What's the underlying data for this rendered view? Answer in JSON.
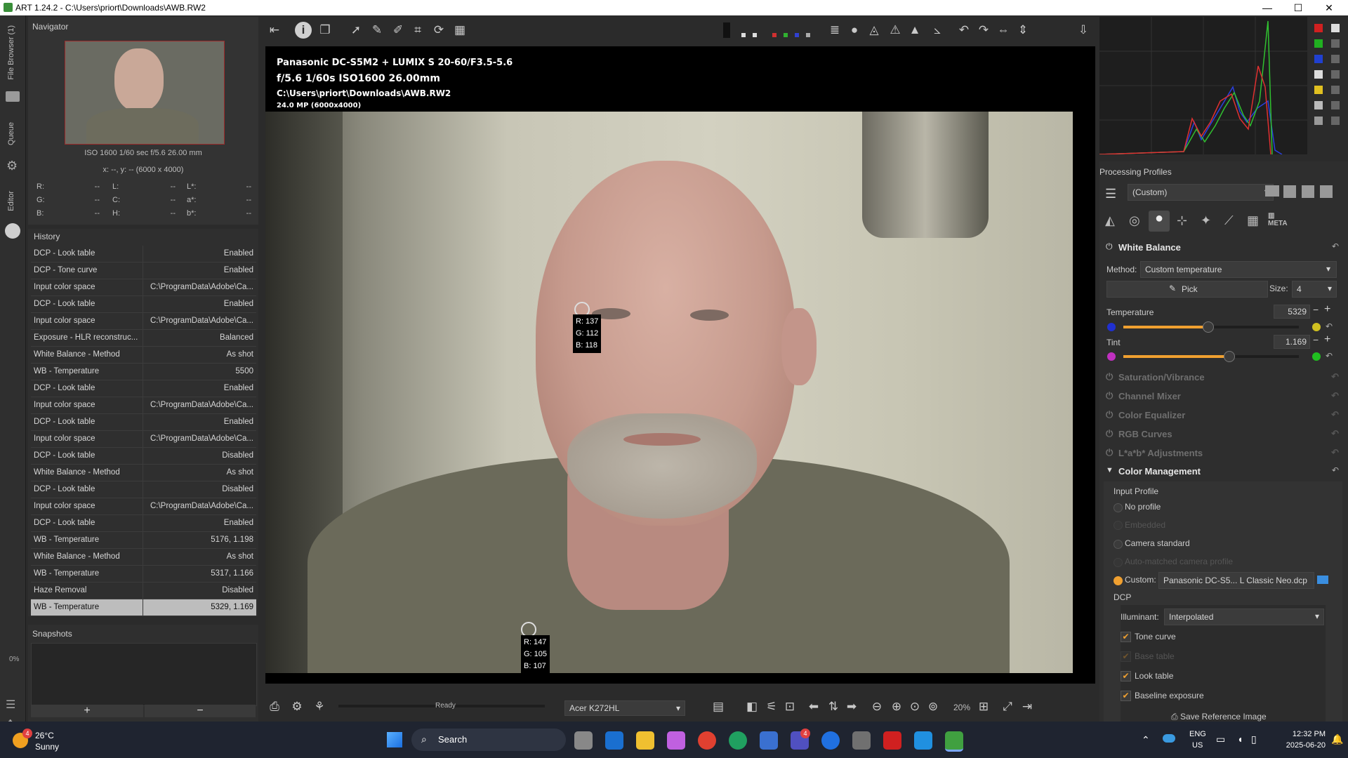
{
  "window": {
    "title": "ART 1.24.2 - C:\\Users\\priort\\Downloads\\AWB.RW2",
    "minimize_icon": "minimize-icon",
    "maximize_icon": "maximize-icon",
    "close_icon": "close-icon"
  },
  "left_tabs": [
    "File Browser (1)",
    "Queue",
    "Editor"
  ],
  "navigator": {
    "title": "Navigator",
    "exif": "ISO 1600   1/60 sec   f/5.6   26.00 mm",
    "coords": "x: --, y: --    (6000 x 4000)",
    "readouts": [
      {
        "k1": "R:",
        "v1": "--",
        "k2": "L:",
        "v2": "--",
        "k3": "L*:",
        "v3": "--"
      },
      {
        "k1": "G:",
        "v1": "--",
        "k2": "C:",
        "v2": "--",
        "k3": "a*:",
        "v3": "--"
      },
      {
        "k1": "B:",
        "v1": "--",
        "k2": "H:",
        "v2": "--",
        "k3": "b*:",
        "v3": "--"
      }
    ]
  },
  "history": {
    "title": "History",
    "rows": [
      {
        "name": "DCP - Look table",
        "value": "Enabled"
      },
      {
        "name": "DCP - Tone curve",
        "value": "Enabled"
      },
      {
        "name": "Input color space",
        "value": "C:\\ProgramData\\Adobe\\Ca..."
      },
      {
        "name": "DCP - Look table",
        "value": "Enabled"
      },
      {
        "name": "Input color space",
        "value": "C:\\ProgramData\\Adobe\\Ca..."
      },
      {
        "name": "Exposure - HLR reconstruc...",
        "value": "Balanced"
      },
      {
        "name": "White Balance - Method",
        "value": "As shot"
      },
      {
        "name": "WB - Temperature",
        "value": "5500"
      },
      {
        "name": "DCP - Look table",
        "value": "Enabled"
      },
      {
        "name": "Input color space",
        "value": "C:\\ProgramData\\Adobe\\Ca..."
      },
      {
        "name": "DCP - Look table",
        "value": "Enabled"
      },
      {
        "name": "Input color space",
        "value": "C:\\ProgramData\\Adobe\\Ca..."
      },
      {
        "name": "DCP - Look table",
        "value": "Disabled"
      },
      {
        "name": "White Balance - Method",
        "value": "As shot"
      },
      {
        "name": "DCP - Look table",
        "value": "Disabled"
      },
      {
        "name": "Input color space",
        "value": "C:\\ProgramData\\Adobe\\Ca..."
      },
      {
        "name": "DCP - Look table",
        "value": "Enabled"
      },
      {
        "name": "WB - Temperature",
        "value": "5176, 1.198"
      },
      {
        "name": "White Balance - Method",
        "value": "As shot"
      },
      {
        "name": "WB - Temperature",
        "value": "5317, 1.166"
      },
      {
        "name": "Haze Removal",
        "value": "Disabled"
      },
      {
        "name": "WB - Temperature",
        "value": "5329, 1.169"
      }
    ]
  },
  "snapshots": {
    "title": "Snapshots",
    "add": "+",
    "remove": "−"
  },
  "left_bottom": {
    "percent": "0%"
  },
  "image_overlay": {
    "camera": "Panasonic DC-S5M2  +  LUMIX S 20-60/F3.5-5.6",
    "exposure": "f/5.6  1/60s  ISO1600  26.00mm",
    "path": "C:\\Users\\priort\\Downloads\\AWB.RW2",
    "megapixels": "24.0 MP (6000x4000)"
  },
  "pickers": [
    {
      "r": "R: 137",
      "g": "G: 112",
      "b": "B: 118"
    },
    {
      "r": "R: 147",
      "g": "G: 105",
      "b": "B: 107"
    }
  ],
  "statusbar": {
    "status": "Ready",
    "monitor_profile": "Acer K272HL",
    "zoom": "20%"
  },
  "processing_profiles": {
    "title": "Processing Profiles",
    "current": "(Custom)"
  },
  "white_balance": {
    "title": "White Balance",
    "method_label": "Method:",
    "method_value": "Custom temperature",
    "pick_label": "Pick",
    "size_label": "Size:",
    "size_value": "4",
    "temperature_label": "Temperature",
    "temperature_value": "5329",
    "temperature_position": 0.48,
    "tint_label": "Tint",
    "tint_value": "1.169",
    "tint_position": 0.6
  },
  "sections": [
    "Saturation/Vibrance",
    "Channel Mixer",
    "Color Equalizer",
    "RGB Curves",
    "L*a*b* Adjustments"
  ],
  "color_management": {
    "title": "Color Management",
    "input_profile_label": "Input Profile",
    "options": [
      "No profile",
      "Embedded",
      "Camera standard",
      "Auto-matched camera profile"
    ],
    "custom_label": "Custom:",
    "custom_value": "Panasonic DC-S5... L Classic Neo.dcp",
    "dcp_label": "DCP",
    "illuminant_label": "Illuminant:",
    "illuminant_value": "Interpolated",
    "checks": [
      {
        "label": "Tone curve",
        "checked": true,
        "enabled": true
      },
      {
        "label": "Base table",
        "checked": true,
        "enabled": false
      },
      {
        "label": "Look table",
        "checked": true,
        "enabled": true
      },
      {
        "label": "Baseline exposure",
        "checked": true,
        "enabled": true
      }
    ],
    "save_reference": "Save Reference Image"
  },
  "taskbar": {
    "weather_temp": "26°C",
    "weather_desc": "Sunny",
    "weather_badge": "4",
    "search": "Search",
    "teams_badge": "4",
    "lang1": "ENG",
    "lang2": "US",
    "time": "12:32 PM",
    "date": "2025-06-20"
  },
  "colors": {
    "accent": "#f0a030",
    "panel": "#2e2e2e",
    "selected_row": "#bdbdbd"
  }
}
